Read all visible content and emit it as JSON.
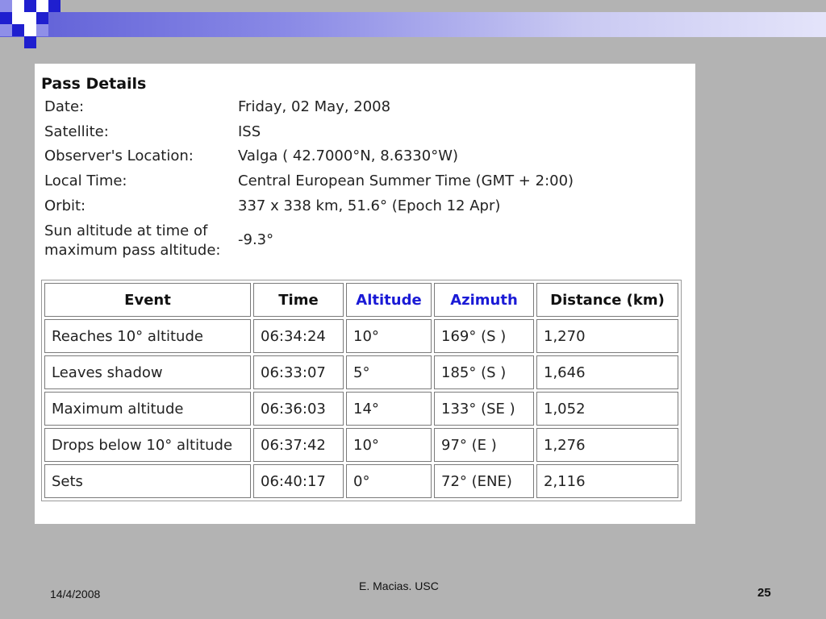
{
  "pass_details": {
    "title": "Pass Details",
    "rows": [
      {
        "label": "Date:",
        "value": "Friday, 02 May, 2008"
      },
      {
        "label": "Satellite:",
        "value": "ISS"
      },
      {
        "label": "Observer's Location:",
        "value": "Valga ( 42.7000°N, 8.6330°W)"
      },
      {
        "label": "Local Time:",
        "value": "Central European Summer Time (GMT + 2:00)"
      },
      {
        "label": "Orbit:",
        "value": "337 x 338 km, 51.6° (Epoch 12 Apr)"
      }
    ],
    "sun_label_line1": "Sun altitude at time of",
    "sun_label_line2": "maximum pass altitude:",
    "sun_value": "-9.3°"
  },
  "events_table": {
    "headers": [
      "Event",
      "Time",
      "Altitude",
      "Azimuth",
      "Distance (km)"
    ],
    "header_link_color": "#1a1ad6",
    "rows": [
      [
        "Reaches 10° altitude",
        "06:34:24",
        "10°",
        "169° (S )",
        "1,270"
      ],
      [
        "Leaves shadow",
        "06:33:07",
        "5°",
        "185° (S )",
        "1,646"
      ],
      [
        "Maximum altitude",
        "06:36:03",
        "14°",
        "133° (SE )",
        "1,052"
      ],
      [
        "Drops below 10° altitude",
        "06:37:42",
        "10°",
        "97° (E )",
        "1,276"
      ],
      [
        "Sets",
        "06:40:17",
        "0°",
        "72° (ENE)",
        "2,116"
      ]
    ]
  },
  "footer": {
    "date": "14/4/2008",
    "author": "E. Macias. USC",
    "page": "25"
  }
}
